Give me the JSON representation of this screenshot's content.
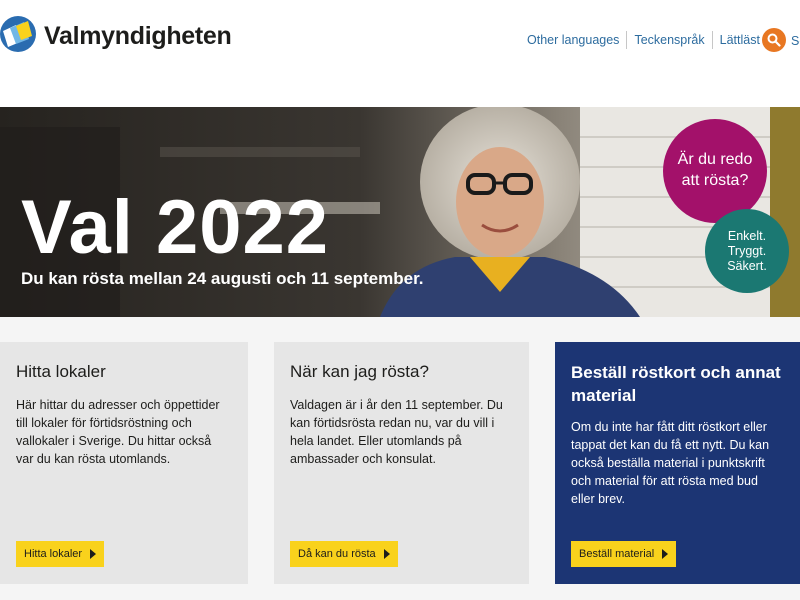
{
  "header": {
    "logo_text": "Valmyndigheten",
    "nav": [
      {
        "label": "Other languages"
      },
      {
        "label": "Teckenspråk"
      },
      {
        "label": "Lättläst"
      }
    ],
    "search_label": "Sö",
    "colors": {
      "link": "#2d6c9f",
      "search": "#e87722"
    }
  },
  "hero": {
    "title": "Val 2022",
    "subtitle": "Du kan rösta mellan 24 augusti och 11 september.",
    "bubble_primary": "Är du redo att rösta?",
    "bubble_secondary": [
      "Enkelt.",
      "Tryggt.",
      "Säkert."
    ],
    "colors": {
      "bubble_primary": "#a3116a",
      "bubble_secondary": "#1b7872"
    }
  },
  "cards": [
    {
      "title": "Hitta lokaler",
      "text": "Här hittar du adresser och öppettider till lokaler för förtidsröstning och vallokaler i Sverige. Du hittar också var du kan rösta utomlands.",
      "button": "Hitta lokaler"
    },
    {
      "title": "När kan jag rösta?",
      "text": "Valdagen är i år den 11 september. Du kan förtidsrösta redan nu, var du vill i hela landet. Eller utomlands på ambassader och konsulat.",
      "button": "Då kan du rösta"
    },
    {
      "title": "Beställ röstkort och annat material",
      "text": "Om du inte har fått ditt röstkort eller tappat det kan du få ett nytt. Du kan också beställa material i punktskrift och material för att rösta med bud eller brev.",
      "button": "Beställ material"
    }
  ],
  "colors": {
    "button": "#f9d21c",
    "card_blue": "#1c3574",
    "card_grey": "#e6e6e6"
  }
}
